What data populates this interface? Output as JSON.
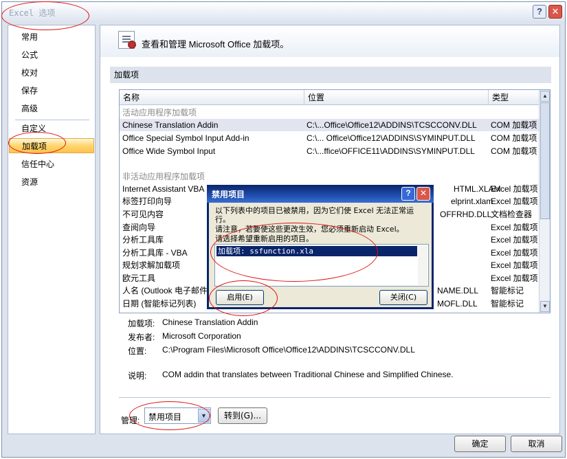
{
  "window": {
    "title": "Excel 选项",
    "help_glyph": "?",
    "close_glyph": "✕"
  },
  "nav": {
    "items": [
      "常用",
      "公式",
      "校对",
      "保存",
      "高级",
      "自定义",
      "加载项",
      "信任中心",
      "资源"
    ],
    "selected": "加载项"
  },
  "header": {
    "text": "查看和管理 Microsoft Office 加载项。"
  },
  "section": {
    "title": "加载项"
  },
  "list": {
    "columns": [
      "名称",
      "位置",
      "类型"
    ],
    "active_group": "活动应用程序加载项",
    "active": [
      {
        "name": "Chinese Translation Addin",
        "location": "C:\\...Office\\Office12\\ADDINS\\TCSCCONV.DLL",
        "type": "COM 加载项"
      },
      {
        "name": "Office Special Symbol Input Add-in",
        "location": "C:\\... Office\\Office12\\ADDINS\\SYMINPUT.DLL",
        "type": "COM 加载项"
      },
      {
        "name": "Office Wide Symbol Input",
        "location": "C:\\...ffice\\OFFICE11\\ADDINS\\SYMINPUT.DLL",
        "type": "COM 加载项"
      }
    ],
    "inactive_group": "非活动应用程序加载项",
    "inactive": [
      {
        "name": "Internet Assistant VBA",
        "location": "HTML.XLAM",
        "type": "Excel 加载项"
      },
      {
        "name": "标签打印向导",
        "location": "elprint.xlam",
        "type": "Excel 加载项"
      },
      {
        "name": "不可见内容",
        "location": "OFFRHD.DLL",
        "type": "文档检查器"
      },
      {
        "name": "查阅向导",
        "location": "",
        "type": "Excel 加载项"
      },
      {
        "name": "分析工具库",
        "location": "",
        "type": "Excel 加载项"
      },
      {
        "name": "分析工具库 - VBA",
        "location": "",
        "type": "Excel 加载项"
      },
      {
        "name": "规划求解加载项",
        "location": "",
        "type": "Excel 加载项"
      },
      {
        "name": "欧元工具",
        "location": "",
        "type": "Excel 加载项"
      },
      {
        "name": "人名 (Outlook 电子邮件",
        "location": "NAME.DLL",
        "type": "智能标记"
      },
      {
        "name": "日期 (智能标记列表)",
        "location": "MOFL.DLL",
        "type": "智能标记"
      }
    ]
  },
  "detail": {
    "addin_label": "加载项:",
    "addin_value": "Chinese Translation Addin",
    "publisher_label": "发布者:",
    "publisher_value": "Microsoft Corporation",
    "location_label": "位置:",
    "location_value": "C:\\Program Files\\Microsoft Office\\Office12\\ADDINS\\TCSCCONV.DLL",
    "desc_label": "说明:",
    "desc_value": "COM addin that translates between Traditional Chinese and Simplified Chinese."
  },
  "manage": {
    "label": "管理:",
    "selected": "禁用项目",
    "goto_label": "转到(G)..."
  },
  "footer": {
    "ok_label": "确定",
    "cancel_label": "取消"
  },
  "modal": {
    "title": "禁用项目",
    "line1": "以下列表中的项目已被禁用，因为它们使 Excel 无法正常运",
    "line2": "行。",
    "line3": "请注意，若要使这些更改生效，您必须重新启动 Excel。",
    "line4": "请选择希望重新启用的项目。",
    "item": "加载项: ssfunction.xla",
    "enable_label": "启用(E)",
    "close_label": "关闭(C)"
  },
  "colors": {
    "annotation": "#dd1111",
    "nav_selected": "#ffd36a",
    "modal_title": "#0a246a"
  }
}
